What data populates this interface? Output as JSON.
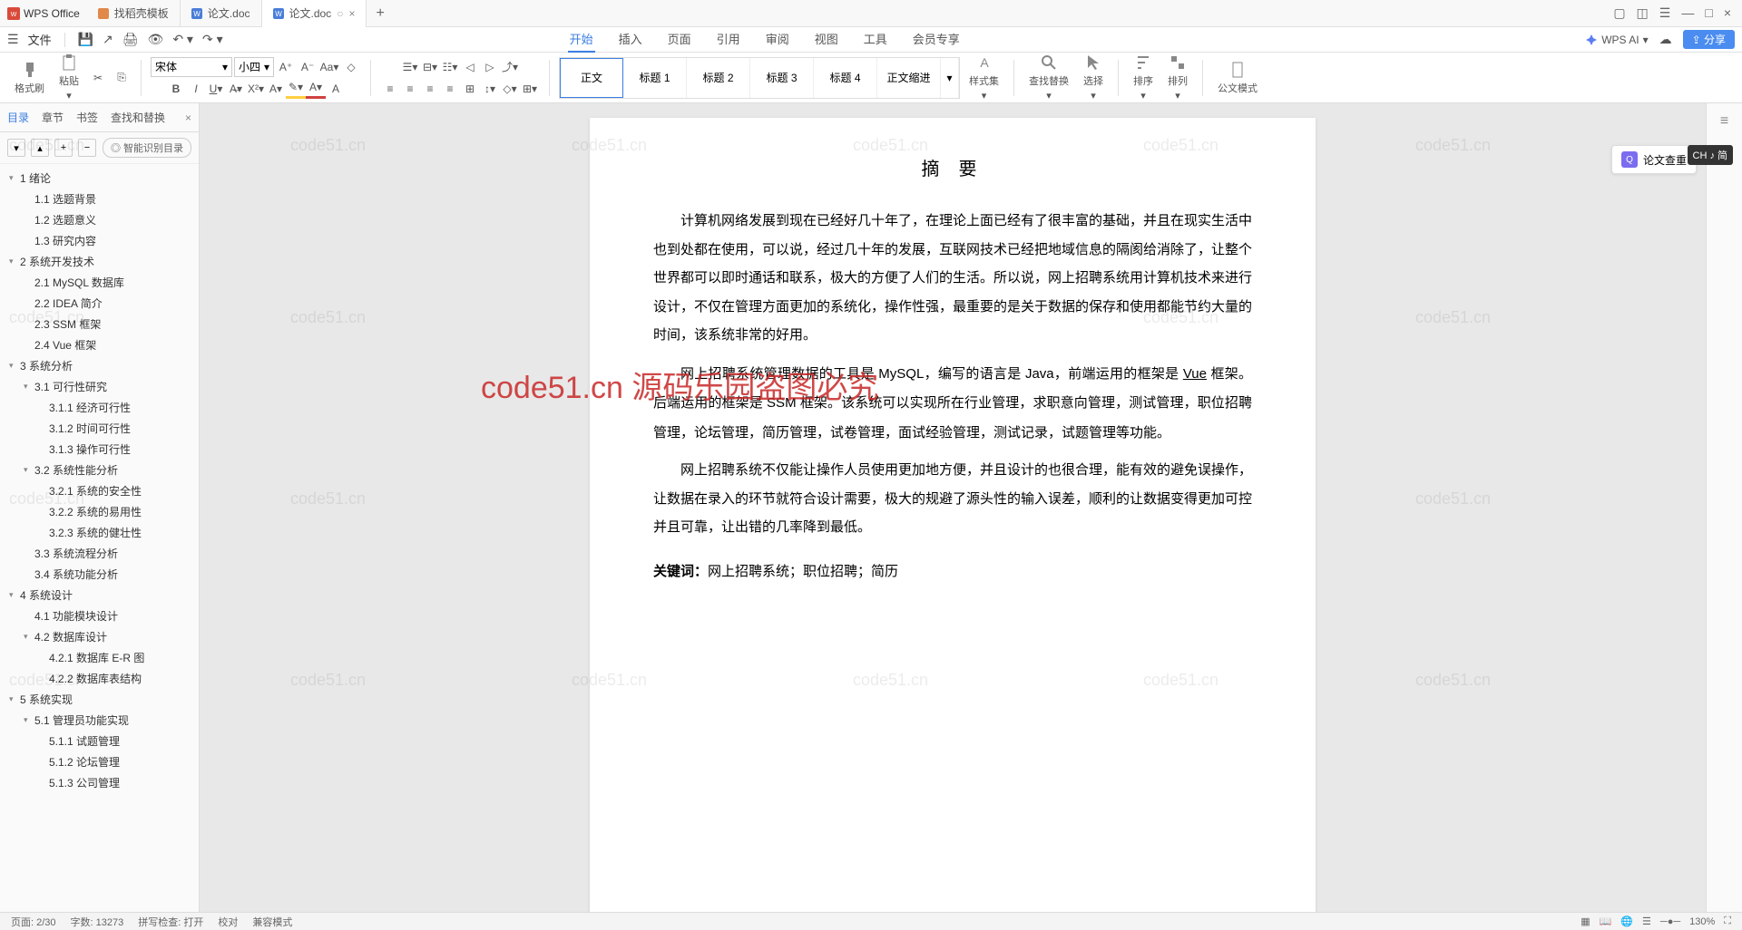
{
  "app": {
    "name": "WPS Office"
  },
  "tabs": [
    {
      "icon": "template",
      "label": "找稻壳模板"
    },
    {
      "icon": "word",
      "label": "论文.doc"
    },
    {
      "icon": "word",
      "label": "论文.doc",
      "active": true
    }
  ],
  "menu": {
    "file": "文件",
    "items": [
      "开始",
      "插入",
      "页面",
      "引用",
      "审阅",
      "视图",
      "工具",
      "会员专享"
    ],
    "active": "开始",
    "ai": "WPS AI",
    "share": "分享"
  },
  "ribbon": {
    "format_painter": "格式刷",
    "paste": "粘贴",
    "font_name": "宋体",
    "font_size": "小四",
    "styles": [
      "正文",
      "标题 1",
      "标题 2",
      "标题 3",
      "标题 4",
      "正文缩进"
    ],
    "style_active": "正文",
    "style_group": "样式集",
    "find": "查找替换",
    "select": "选择",
    "sort": "排序",
    "arrange": "排列",
    "official": "公文模式"
  },
  "sidebar": {
    "tabs": [
      "目录",
      "章节",
      "书签",
      "查找和替换"
    ],
    "active": "目录",
    "smart": "智能识别目录",
    "outline": [
      {
        "lvl": 1,
        "t": "1 绪论",
        "exp": true
      },
      {
        "lvl": 2,
        "t": "1.1 选题背景"
      },
      {
        "lvl": 2,
        "t": "1.2 选题意义"
      },
      {
        "lvl": 2,
        "t": "1.3 研究内容"
      },
      {
        "lvl": 1,
        "t": "2 系统开发技术",
        "exp": true
      },
      {
        "lvl": 2,
        "t": "2.1 MySQL 数据库"
      },
      {
        "lvl": 2,
        "t": "2.2 IDEA 简介"
      },
      {
        "lvl": 2,
        "t": "2.3 SSM 框架"
      },
      {
        "lvl": 2,
        "t": "2.4 Vue 框架"
      },
      {
        "lvl": 1,
        "t": "3 系统分析",
        "exp": true
      },
      {
        "lvl": 2,
        "t": "3.1 可行性研究",
        "exp": true
      },
      {
        "lvl": 3,
        "t": "3.1.1 经济可行性"
      },
      {
        "lvl": 3,
        "t": "3.1.2 时间可行性"
      },
      {
        "lvl": 3,
        "t": "3.1.3 操作可行性"
      },
      {
        "lvl": 2,
        "t": "3.2 系统性能分析",
        "exp": true
      },
      {
        "lvl": 3,
        "t": "3.2.1 系统的安全性"
      },
      {
        "lvl": 3,
        "t": "3.2.2 系统的易用性"
      },
      {
        "lvl": 3,
        "t": "3.2.3 系统的健壮性"
      },
      {
        "lvl": 2,
        "t": "3.3 系统流程分析"
      },
      {
        "lvl": 2,
        "t": "3.4 系统功能分析"
      },
      {
        "lvl": 1,
        "t": "4 系统设计",
        "exp": true
      },
      {
        "lvl": 2,
        "t": "4.1 功能模块设计"
      },
      {
        "lvl": 2,
        "t": "4.2 数据库设计",
        "exp": true
      },
      {
        "lvl": 3,
        "t": "4.2.1 数据库 E-R 图"
      },
      {
        "lvl": 3,
        "t": "4.2.2 数据库表结构"
      },
      {
        "lvl": 1,
        "t": "5 系统实现",
        "exp": true
      },
      {
        "lvl": 2,
        "t": "5.1 管理员功能实现",
        "exp": true
      },
      {
        "lvl": 3,
        "t": "5.1.1 试题管理"
      },
      {
        "lvl": 3,
        "t": "5.1.2 论坛管理"
      },
      {
        "lvl": 3,
        "t": "5.1.3 公司管理"
      }
    ]
  },
  "document": {
    "title": "摘 要",
    "para1": "计算机网络发展到现在已经好几十年了，在理论上面已经有了很丰富的基础，并且在现实生活中也到处都在使用，可以说，经过几十年的发展，互联网技术已经把地域信息的隔阂给消除了，让整个世界都可以即时通话和联系，极大的方便了人们的生活。所以说，网上招聘系统用计算机技术来进行设计，不仅在管理方面更加的系统化，操作性强，最重要的是关于数据的保存和使用都能节约大量的时间，该系统非常的好用。",
    "para2_pre": "网上招聘系统管理数据的工具是 MySQL，编写的语言是 Java，前端运用的框架是 ",
    "para2_vue": "Vue",
    "para2_post": " 框架。后端运用的框架是 SSM 框架。该系统可以实现所在行业管理，求职意向管理，测试管理，职位招聘管理，论坛管理，简历管理，试卷管理，面试经验管理，测试记录，试题管理等功能。",
    "para3": "网上招聘系统不仅能让操作人员使用更加地方便，并且设计的也很合理，能有效的避免误操作，让数据在录入的环节就符合设计需要，极大的规避了源头性的输入误差，顺利的让数据变得更加可控并且可靠，让出错的几率降到最低。",
    "keywords_label": "关键词：",
    "keywords": "网上招聘系统；职位招聘；简历"
  },
  "rightpanel": {
    "check_dup": "论文查重",
    "ime": "CH ♪ 简"
  },
  "status": {
    "page": "页面: 2/30",
    "words": "字数: 13273",
    "spell": "拼写检查: 打开",
    "proof": "校对",
    "compat": "兼容模式",
    "zoom": "130%"
  },
  "watermark": "code51.cn",
  "watermark_red": "code51.cn 源码乐园盗图必究"
}
